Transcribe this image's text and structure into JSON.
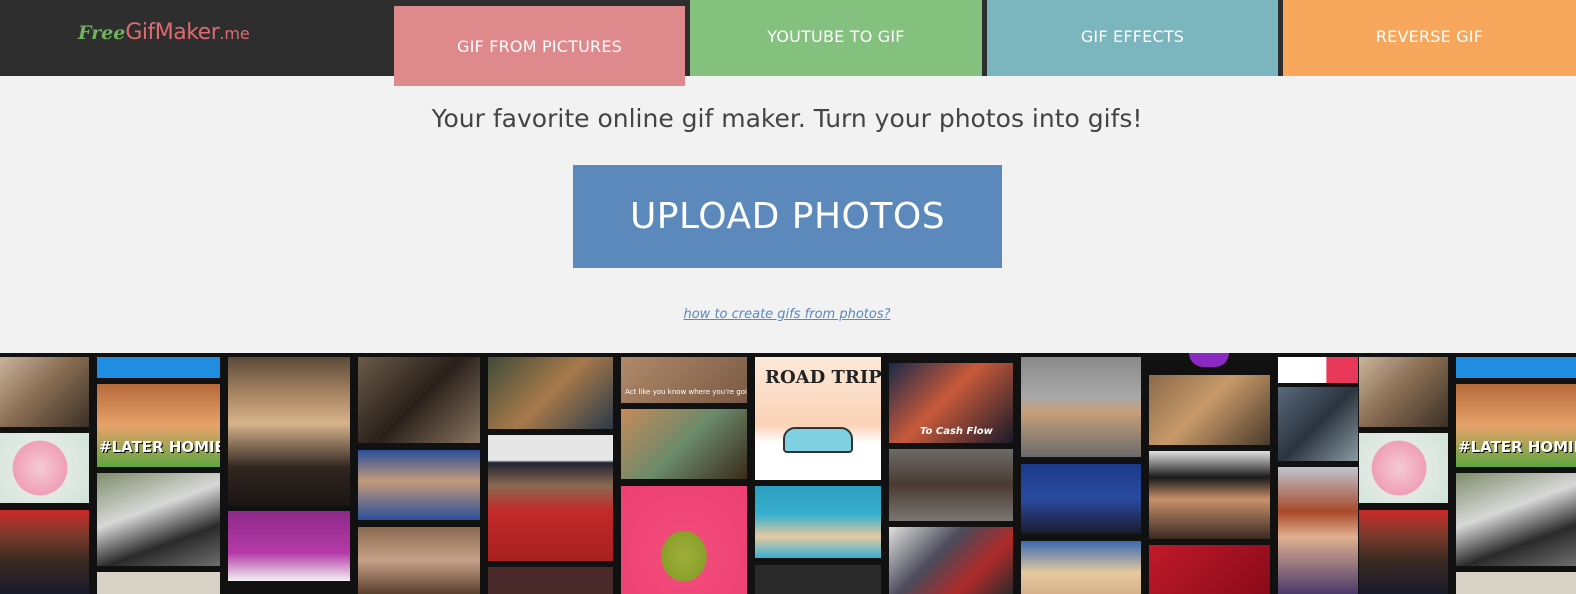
{
  "header": {
    "logo": {
      "free": "Free",
      "main": "GifMaker",
      "tld": ".me"
    },
    "tabs": [
      {
        "label": "GIF FROM PICTURES",
        "color": "#de8a8c",
        "active": true
      },
      {
        "label": "YOUTUBE TO GIF",
        "color": "#84c17f",
        "active": false
      },
      {
        "label": "GIF EFFECTS",
        "color": "#7bb6be",
        "active": false
      },
      {
        "label": "REVERSE GIF",
        "color": "#f6a75c",
        "active": false
      }
    ]
  },
  "main": {
    "tagline": "Your favorite online gif maker. Turn your photos into gifs!",
    "upload_label": "UPLOAD PHOTOS",
    "howto_link": "how to create gifs from photos?"
  },
  "gallery": {
    "captions": {
      "later_homies": "#LATER HOMIES",
      "road_trip": "ROAD TRIP!",
      "cash_flow": "To Cash Flow",
      "act_like": "Act like you know where you're goin"
    }
  },
  "colors": {
    "header_bg": "#2e2e2e",
    "page_bg": "#f2f2f2",
    "accent_blue": "#5b89bb",
    "gallery_bg": "#111111"
  }
}
